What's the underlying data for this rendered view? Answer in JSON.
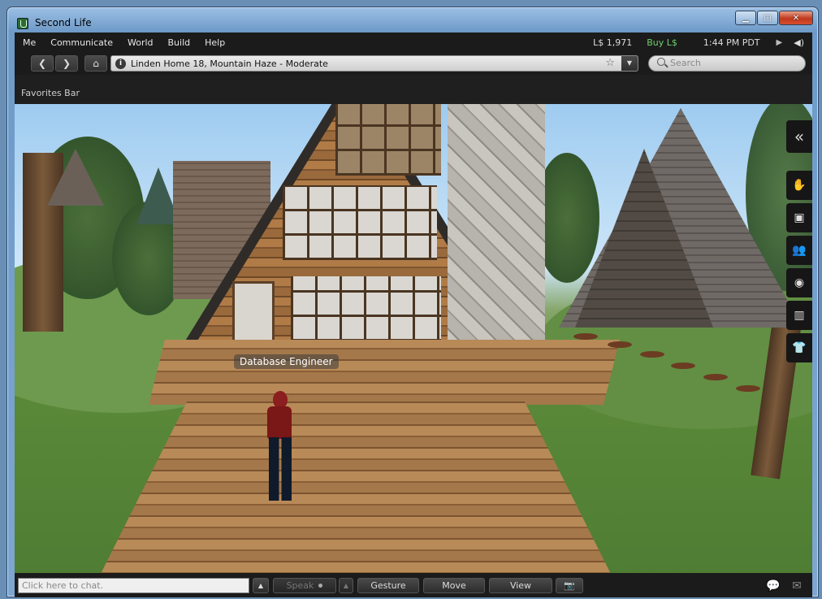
{
  "window": {
    "title": "Second Life"
  },
  "menubar": {
    "items": [
      "Me",
      "Communicate",
      "World",
      "Build",
      "Help"
    ],
    "balance": "L$ 1,971",
    "buy_label": "Buy L$",
    "time": "1:44 PM PDT"
  },
  "navbar": {
    "location": "Linden Home 18, Mountain Haze - Moderate",
    "search_placeholder": "Search"
  },
  "favorites": {
    "label": "Favorites Bar"
  },
  "scene": {
    "nametag": "Database Engineer"
  },
  "sidebar": {
    "tabs": [
      "collapse",
      "home",
      "me",
      "people",
      "places",
      "inventory",
      "appearance"
    ]
  },
  "bottombar": {
    "chat_placeholder": "Click here to chat.",
    "speak": "Speak",
    "gesture": "Gesture",
    "move": "Move",
    "view": "View"
  }
}
